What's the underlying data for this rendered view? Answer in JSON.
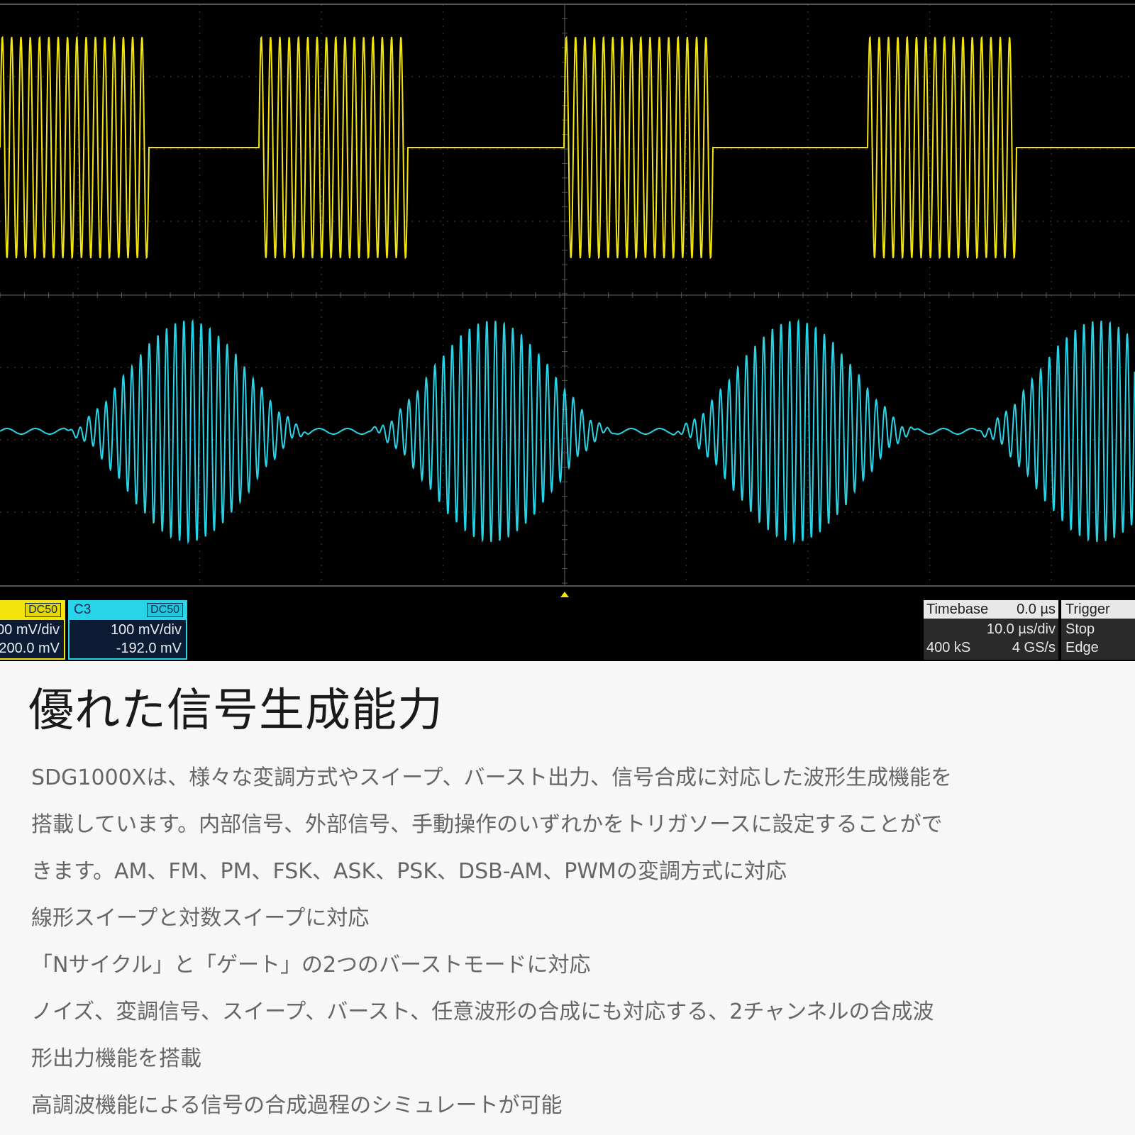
{
  "oscilloscope": {
    "colors": {
      "channel1": "#f2e40c",
      "channel3": "#27d4e8",
      "grid": "#3a3a3a",
      "trigger_marker": "#f2e40c"
    },
    "channel1": {
      "name": "",
      "coupling": "DC50",
      "volts_per_div": "00 mV/div",
      "offset": "200.0 mV",
      "waveform": "burst"
    },
    "channel3": {
      "name": "C3",
      "coupling": "DC50",
      "volts_per_div": "100 mV/div",
      "offset": "-192.0 mV",
      "waveform": "amplitude-modulated sine"
    },
    "timebase": {
      "label": "Timebase",
      "delay": "0.0 µs",
      "scale": "10.0 µs/div",
      "points": "400 kS",
      "sample_rate": "4 GS/s"
    },
    "trigger": {
      "label": "Trigger",
      "mode": "Stop",
      "type": "Edge"
    }
  },
  "section": {
    "title": "優れた信号生成能力",
    "lines": [
      "SDG1000Xは、様々な変調方式やスイープ、バースト出力、信号合成に対応した波形生成機能を",
      "搭載しています。内部信号、外部信号、手動操作のいずれかをトリガソースに設定することがで",
      "きます。AM、FM、PM、FSK、ASK、PSK、DSB-AM、PWMの変調方式に対応",
      "線形スイープと対数スイープに対応",
      "「Nサイクル」と「ゲート」の2つのバーストモードに対応",
      "ノイズ、変調信号、スイープ、バースト、任意波形の合成にも対応する、2チャンネルの合成波",
      "形出力機能を搭載",
      "高調波機能による信号の合成過程のシミュレートが可能"
    ]
  }
}
